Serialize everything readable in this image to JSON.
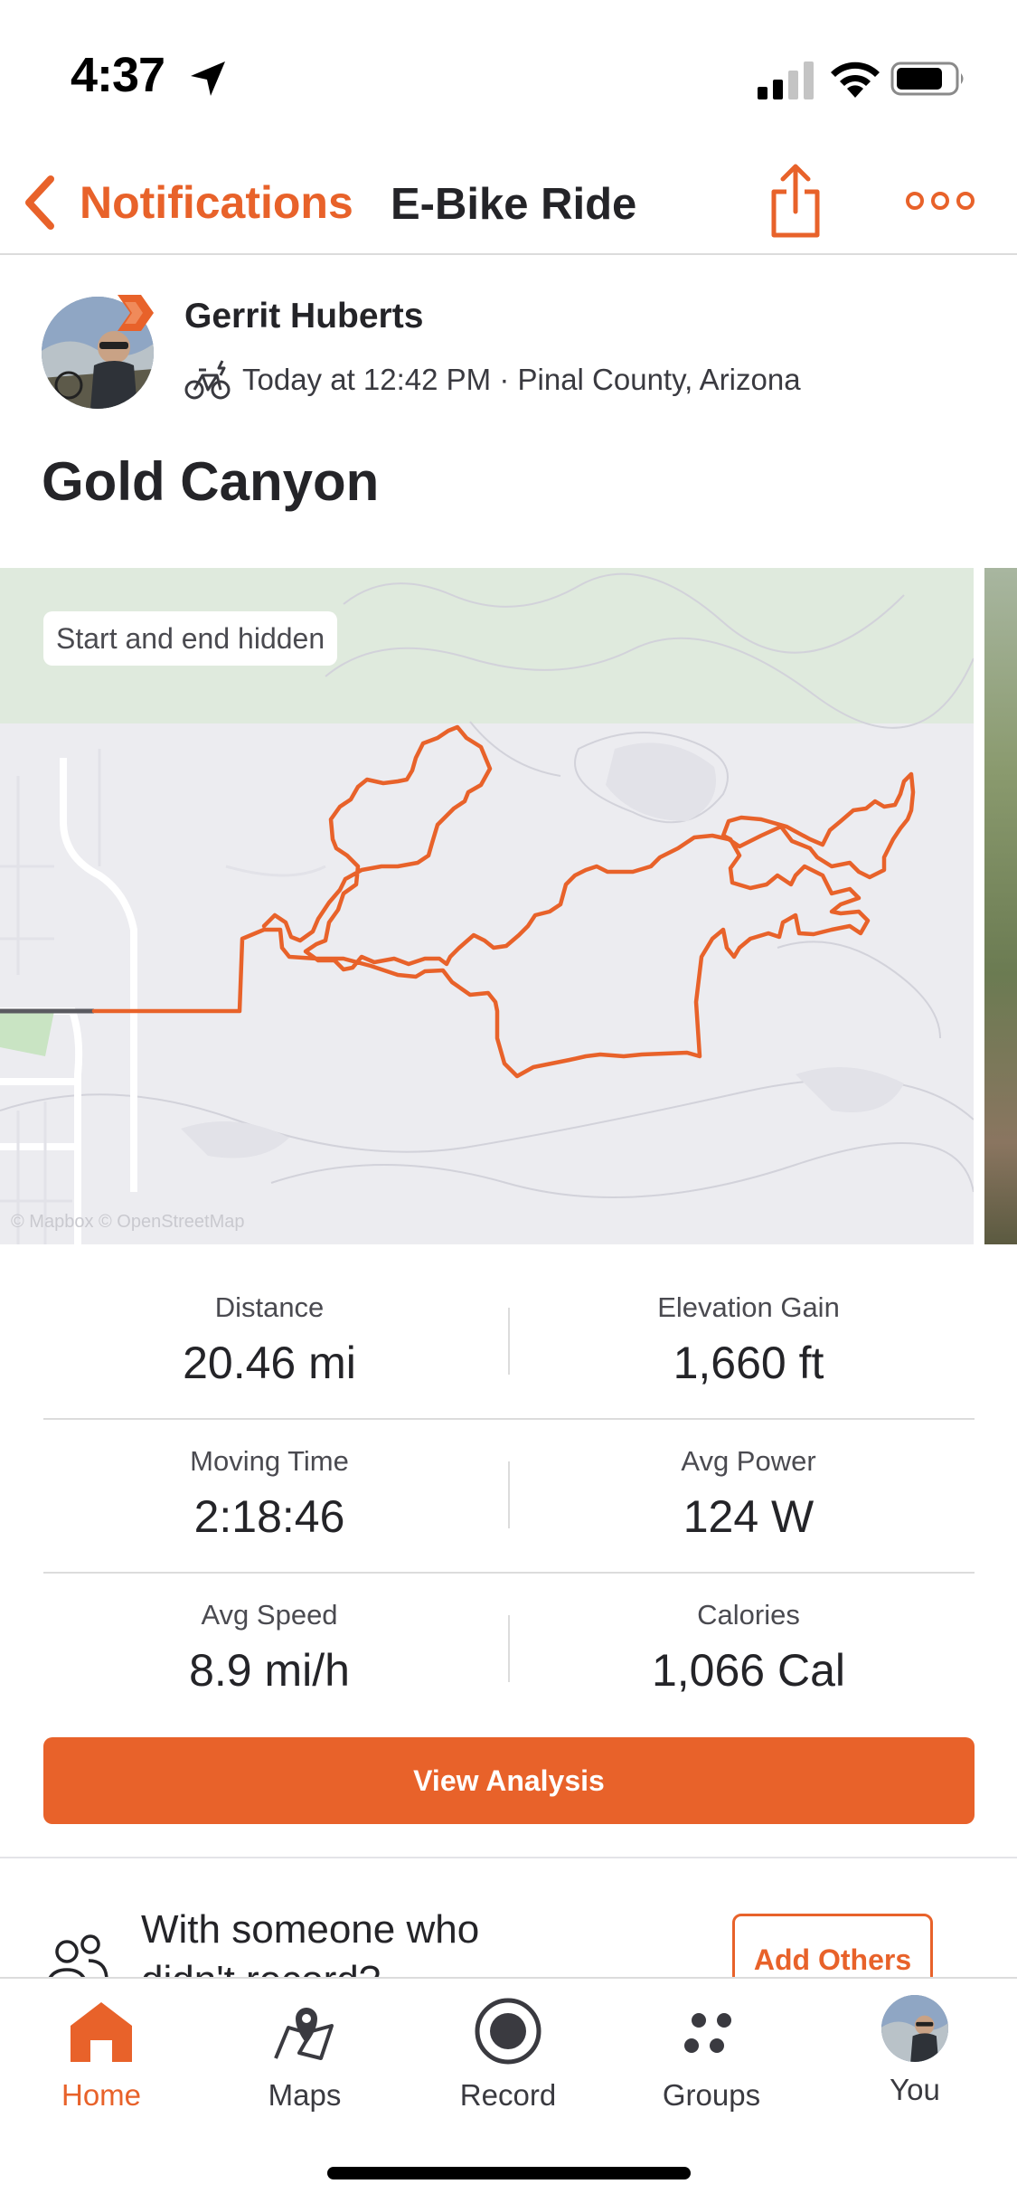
{
  "status_bar": {
    "time": "4:37"
  },
  "nav": {
    "back_label": "Notifications",
    "title": "E-Bike Ride"
  },
  "athlete": {
    "name": "Gerrit Huberts",
    "meta": "Today at 12:42 PM · Pinal County, Arizona"
  },
  "activity": {
    "title": "Gold Canyon"
  },
  "map": {
    "privacy_pill": "Start and end hidden",
    "attribution": "© Mapbox © OpenStreetMap"
  },
  "stats": [
    {
      "label": "Distance",
      "value": "20.46 mi"
    },
    {
      "label": "Elevation Gain",
      "value": "1,660 ft"
    },
    {
      "label": "Moving Time",
      "value": "2:18:46"
    },
    {
      "label": "Avg Power",
      "value": "124 W"
    },
    {
      "label": "Avg Speed",
      "value": "8.9 mi/h"
    },
    {
      "label": "Calories",
      "value": "1,066 Cal"
    }
  ],
  "cta": {
    "label": "View Analysis"
  },
  "with_someone": {
    "text": "With someone who didn't record?",
    "button": "Add Others"
  },
  "tabs": [
    {
      "label": "Home",
      "icon": "home-icon",
      "active": true
    },
    {
      "label": "Maps",
      "icon": "maps-icon",
      "active": false
    },
    {
      "label": "Record",
      "icon": "record-icon",
      "active": false
    },
    {
      "label": "Groups",
      "icon": "groups-icon",
      "active": false
    },
    {
      "label": "You",
      "icon": "avatar",
      "active": false
    }
  ],
  "colors": {
    "accent": "#e8622a",
    "text": "#242428",
    "divider": "#dcdcdc",
    "map_background": "#ececf0",
    "map_park": "#dfeadd"
  }
}
